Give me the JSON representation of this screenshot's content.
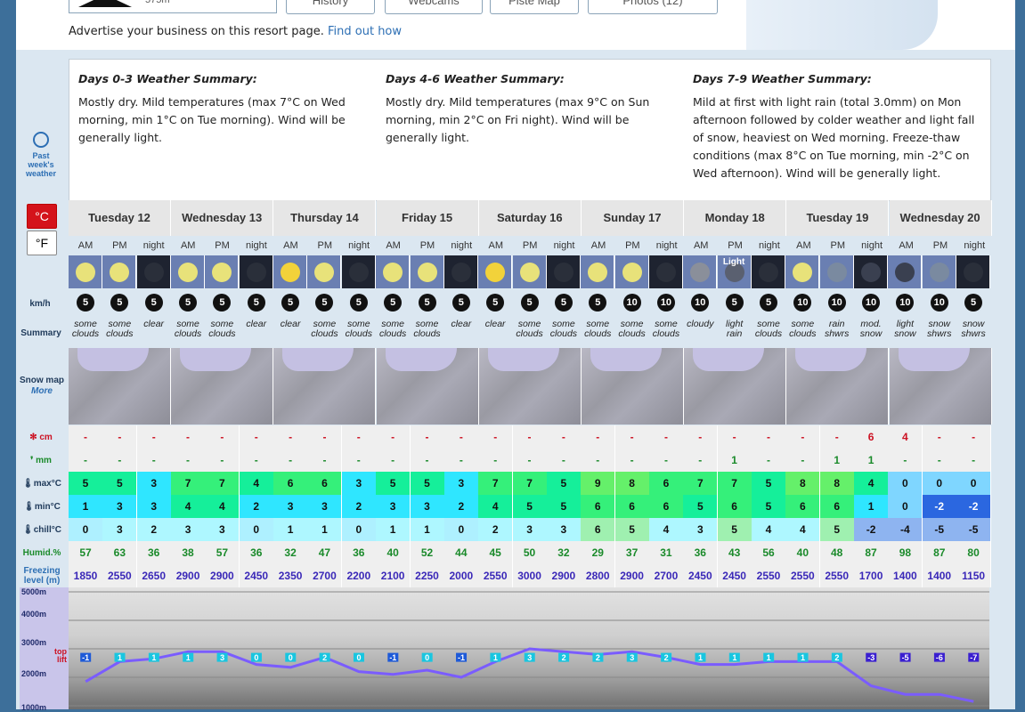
{
  "top": {
    "altitude": "575m",
    "tabs": [
      "History",
      "Webcams",
      "Piste Map",
      "Photos (12)"
    ],
    "advert_text": "Advertise your business on this resort page.",
    "advert_link": "Find out how"
  },
  "past_weather": [
    "Past",
    "week's",
    "weather"
  ],
  "summaries": [
    {
      "title": "Days 0-3 Weather Summary:",
      "text": "Mostly dry. Mild temperatures (max 7°C on Wed morning, min 1°C on Tue morning). Wind will be generally light."
    },
    {
      "title": "Days 4-6 Weather Summary:",
      "text": "Mostly dry. Mild temperatures (max 9°C on Sun morning, min 2°C on Fri night). Wind will be generally light."
    },
    {
      "title": "Days 7-9 Weather Summary:",
      "text": "Mild at first with light rain (total 3.0mm) on Mon afternoon followed by colder weather and light fall of snow, heaviest on Wed morning. Freeze-thaw conditions (max 8°C on Tue morning, min -2°C on Wed afternoon). Wind will be generally light."
    }
  ],
  "units": {
    "c": "°C",
    "f": "°F"
  },
  "labels": {
    "wind": "km/h",
    "summary": "Summary",
    "snowmap": "Snow map",
    "more": "More",
    "snow": "cm",
    "rain": "mm",
    "max": "max°C",
    "min": "min°C",
    "chill": "chill°C",
    "humid": "Humid.%",
    "freezing": "Freezing level (m)",
    "top_lift": "top lift"
  },
  "periods": [
    "AM",
    "PM",
    "night"
  ],
  "days": [
    "Tuesday 12",
    "Wednesday 13",
    "Thursday 14",
    "Friday 15",
    "Saturday 16",
    "Sunday 17",
    "Monday 18",
    "Tuesday 19",
    "Wednesday 20"
  ],
  "icon_light_label": "Light",
  "wind": [
    "5",
    "5",
    "5",
    "5",
    "5",
    "5",
    "5",
    "5",
    "5",
    "5",
    "5",
    "5",
    "5",
    "5",
    "5",
    "5",
    "10",
    "10",
    "10",
    "5",
    "5",
    "10",
    "10",
    "10",
    "10",
    "10",
    "5"
  ],
  "summary": [
    "some clouds",
    "some clouds",
    "clear",
    "some clouds",
    "some clouds",
    "clear",
    "clear",
    "some clouds",
    "some clouds",
    "some clouds",
    "some clouds",
    "clear",
    "clear",
    "some clouds",
    "some clouds",
    "some clouds",
    "some clouds",
    "some clouds",
    "cloudy",
    "light rain",
    "some clouds",
    "some clouds",
    "rain shwrs",
    "mod. snow",
    "light snow",
    "snow shwrs",
    "snow shwrs"
  ],
  "snow_cm": [
    "-",
    "-",
    "-",
    "-",
    "-",
    "-",
    "-",
    "-",
    "-",
    "-",
    "-",
    "-",
    "-",
    "-",
    "-",
    "-",
    "-",
    "-",
    "-",
    "-",
    "-",
    "-",
    "-",
    "6",
    "4",
    "-",
    "-"
  ],
  "rain_mm": [
    "-",
    "-",
    "-",
    "-",
    "-",
    "-",
    "-",
    "-",
    "-",
    "-",
    "-",
    "-",
    "-",
    "-",
    "-",
    "-",
    "-",
    "-",
    "-",
    "1",
    "-",
    "-",
    "1",
    "1",
    "-",
    "-",
    "-"
  ],
  "max_c": [
    "5",
    "5",
    "3",
    "7",
    "7",
    "4",
    "6",
    "6",
    "3",
    "5",
    "5",
    "3",
    "7",
    "7",
    "5",
    "9",
    "8",
    "6",
    "7",
    "7",
    "5",
    "8",
    "8",
    "4",
    "0",
    "0",
    "0"
  ],
  "min_c": [
    "1",
    "3",
    "3",
    "4",
    "4",
    "2",
    "3",
    "3",
    "2",
    "3",
    "3",
    "2",
    "4",
    "5",
    "5",
    "6",
    "6",
    "6",
    "5",
    "6",
    "5",
    "6",
    "6",
    "1",
    "0",
    "-2",
    "-2"
  ],
  "chill_c": [
    "0",
    "3",
    "2",
    "3",
    "3",
    "0",
    "1",
    "1",
    "0",
    "1",
    "1",
    "0",
    "2",
    "3",
    "3",
    "6",
    "5",
    "4",
    "3",
    "5",
    "4",
    "4",
    "5",
    "-2",
    "-4",
    "-5",
    "-5"
  ],
  "humid": [
    "57",
    "63",
    "36",
    "38",
    "57",
    "36",
    "32",
    "47",
    "36",
    "40",
    "52",
    "44",
    "45",
    "50",
    "32",
    "29",
    "37",
    "31",
    "36",
    "43",
    "56",
    "40",
    "48",
    "87",
    "98",
    "87",
    "80"
  ],
  "freezing": [
    "1850",
    "2550",
    "2650",
    "2900",
    "2900",
    "2450",
    "2350",
    "2700",
    "2200",
    "2100",
    "2250",
    "2000",
    "2550",
    "3000",
    "2900",
    "2800",
    "2900",
    "2700",
    "2450",
    "2450",
    "2550",
    "2550",
    "2550",
    "1700",
    "1400",
    "1400",
    "1150"
  ],
  "chart_axis": [
    "5000m",
    "4000m",
    "3000m",
    "2000m",
    "1000m"
  ],
  "chart_temps": [
    "-1",
    "1",
    "1",
    "1",
    "3",
    "0",
    "0",
    "2",
    "0",
    "-1",
    "0",
    "-1",
    "1",
    "3",
    "2",
    "2",
    "3",
    "2",
    "1",
    "1",
    "1",
    "1",
    "2",
    "-3",
    "-5",
    "-6",
    "-7"
  ]
}
